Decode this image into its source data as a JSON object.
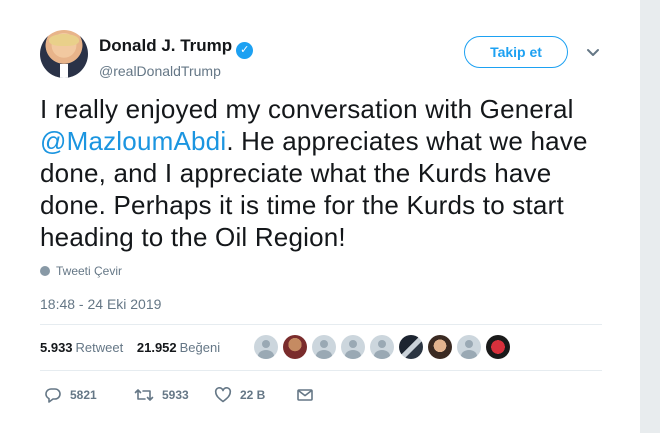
{
  "tweet": {
    "author": {
      "display_name": "Donald J. Trump",
      "handle": "@realDonaldTrump",
      "verified_icon": "verified-badge-icon",
      "brand_color": "#1da1f2"
    },
    "follow_label": "Takip et",
    "text": {
      "before_mention": "I really enjoyed my conversation with General ",
      "mention": "@MazloumAbdi",
      "after_mention": ". He appreciates what we have done, and I appreciate what the Kurds have done. Perhaps it is time for the Kurds to start heading to the Oil Region!"
    },
    "translate_label": "Tweeti Çevir",
    "timestamp": "18:48 - 24 Eki 2019",
    "stats": {
      "retweets_value": "5.933",
      "retweets_label": "Retweet",
      "likes_value": "21.952",
      "likes_label": "Beğeni"
    },
    "liker_avatar_count": 9,
    "actions": {
      "replies": "5821",
      "retweets": "5933",
      "likes": "22 B"
    }
  }
}
